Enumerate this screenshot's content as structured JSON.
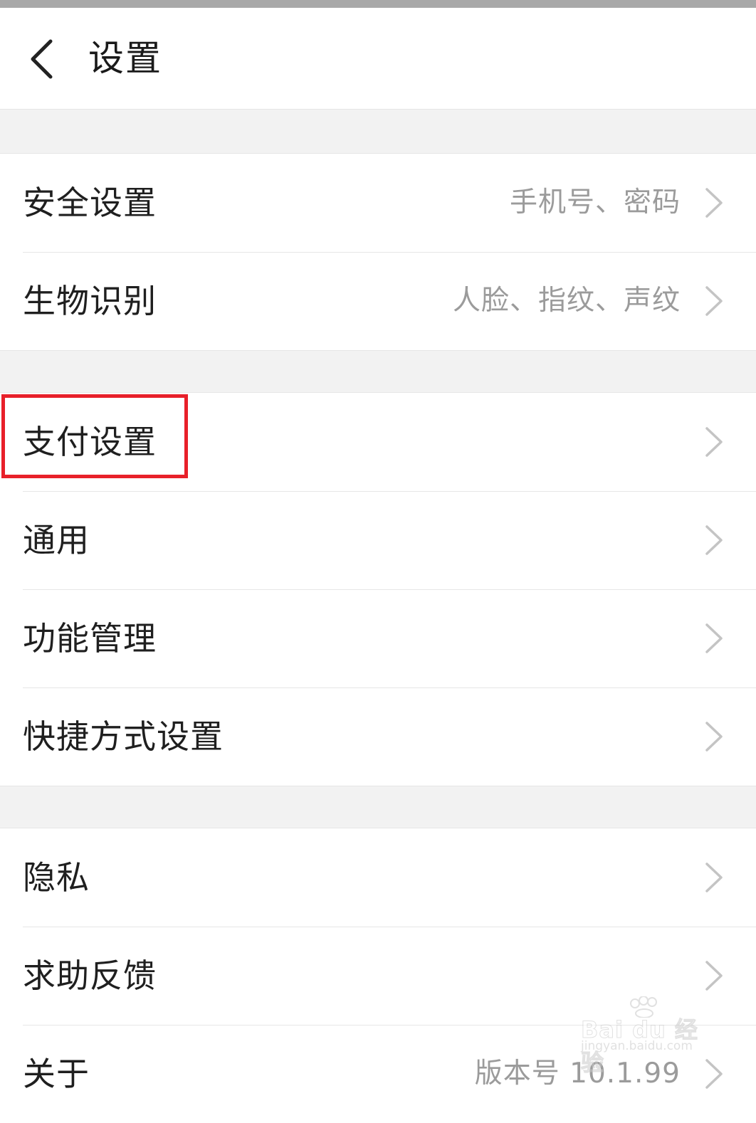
{
  "header": {
    "title": "设置",
    "back_icon": "chevron-left-icon"
  },
  "groups": [
    {
      "items": [
        {
          "label": "安全设置",
          "value": "手机号、密码"
        },
        {
          "label": "生物识别",
          "value": "人脸、指纹、声纹"
        }
      ]
    },
    {
      "items": [
        {
          "label": "支付设置",
          "value": ""
        },
        {
          "label": "通用",
          "value": ""
        },
        {
          "label": "功能管理",
          "value": ""
        },
        {
          "label": "快捷方式设置",
          "value": ""
        }
      ]
    },
    {
      "items": [
        {
          "label": "隐私",
          "value": ""
        },
        {
          "label": "求助反馈",
          "value": ""
        },
        {
          "label": "关于",
          "value": "版本号 10.1.99"
        }
      ]
    }
  ],
  "highlight": {
    "target": "支付设置",
    "color": "#e8202a"
  },
  "watermark": {
    "brand": "Bai du 经验",
    "url": "jingyan.baidu.com"
  },
  "colors": {
    "background": "#f2f2f2",
    "row_bg": "#ffffff",
    "label": "#1f1f1f",
    "value": "#9b9b9b",
    "chevron": "#c4c4c4"
  }
}
